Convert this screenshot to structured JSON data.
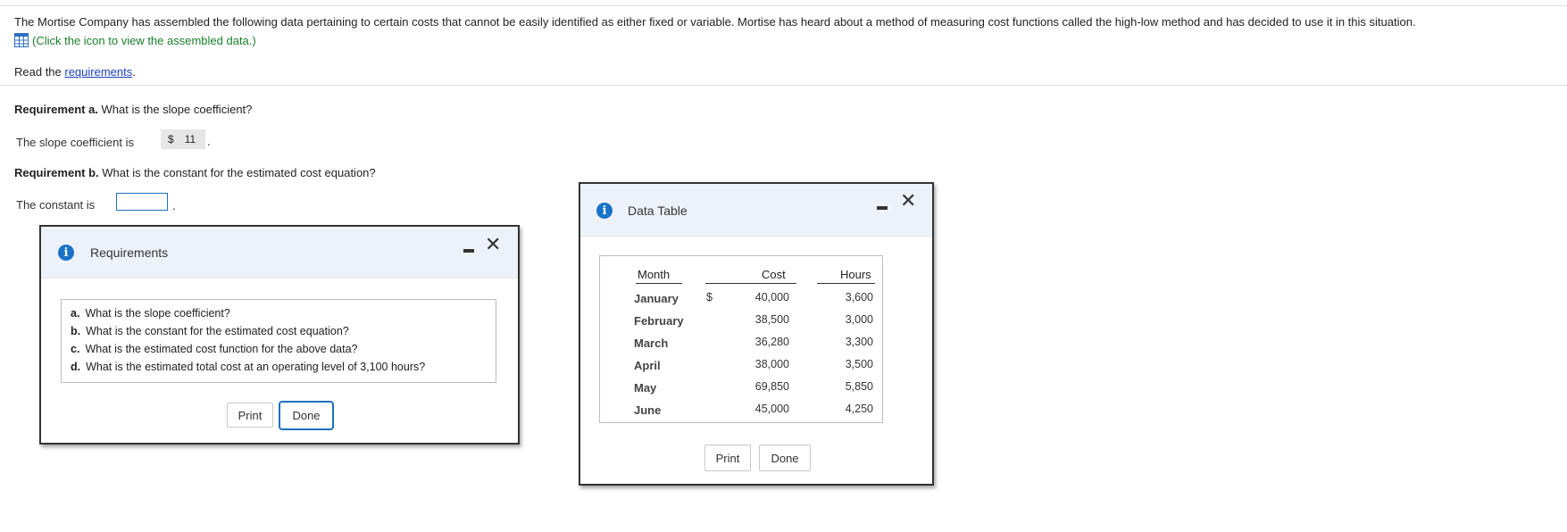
{
  "intro": "The Mortise Company has assembled the following data pertaining to certain costs that cannot be easily identified as either fixed or variable. Mortise has heard about a method of measuring cost functions called the high-low method and has decided to use it in this situation.",
  "click_data": "(Click the icon to view the assembled data.)",
  "read_prefix": "Read the ",
  "read_link": "requirements",
  "read_suffix": ".",
  "requirement_a": {
    "label": "Requirement a.",
    "text": " What is the slope coefficient?"
  },
  "slope": {
    "label": "The slope coefficient is",
    "currency": "$",
    "value": "11",
    "suffix": "."
  },
  "requirement_b": {
    "label": "Requirement b.",
    "text": " What is the constant for the estimated cost equation?"
  },
  "constant": {
    "label": "The constant is",
    "value": "",
    "suffix": "."
  },
  "requirements_dialog": {
    "title": "Requirements",
    "items": [
      {
        "letter": "a.",
        "text": "What is the slope coefficient?"
      },
      {
        "letter": "b.",
        "text": "What is the constant for the estimated cost equation?"
      },
      {
        "letter": "c.",
        "text": "What is the estimated cost function for the above data?"
      },
      {
        "letter": "d.",
        "text": "What is the estimated total cost at an operating level of 3,100 hours?"
      }
    ],
    "print_label": "Print",
    "done_label": "Done"
  },
  "data_dialog": {
    "title": "Data Table",
    "headers": {
      "month": "Month",
      "cost": "Cost",
      "hours": "Hours"
    },
    "currency": "$",
    "rows": [
      {
        "month": "January",
        "cost": "40,000",
        "hours": "3,600"
      },
      {
        "month": "February",
        "cost": "38,500",
        "hours": "3,000"
      },
      {
        "month": "March",
        "cost": "36,280",
        "hours": "3,300"
      },
      {
        "month": "April",
        "cost": "38,000",
        "hours": "3,500"
      },
      {
        "month": "May",
        "cost": "69,850",
        "hours": "5,850"
      },
      {
        "month": "June",
        "cost": "45,000",
        "hours": "4,250"
      }
    ],
    "print_label": "Print",
    "done_label": "Done"
  },
  "colors": {
    "link": "#1a3fbf",
    "green_hint": "#1a7f2b",
    "info_icon": "#1a73c8",
    "focus": "#1f6fbf",
    "dialog_header": "#edf2f9"
  },
  "icons": {
    "data": "table-grid-icon",
    "info": "info-icon",
    "minimize": "minimize-icon",
    "close": "close-icon"
  }
}
